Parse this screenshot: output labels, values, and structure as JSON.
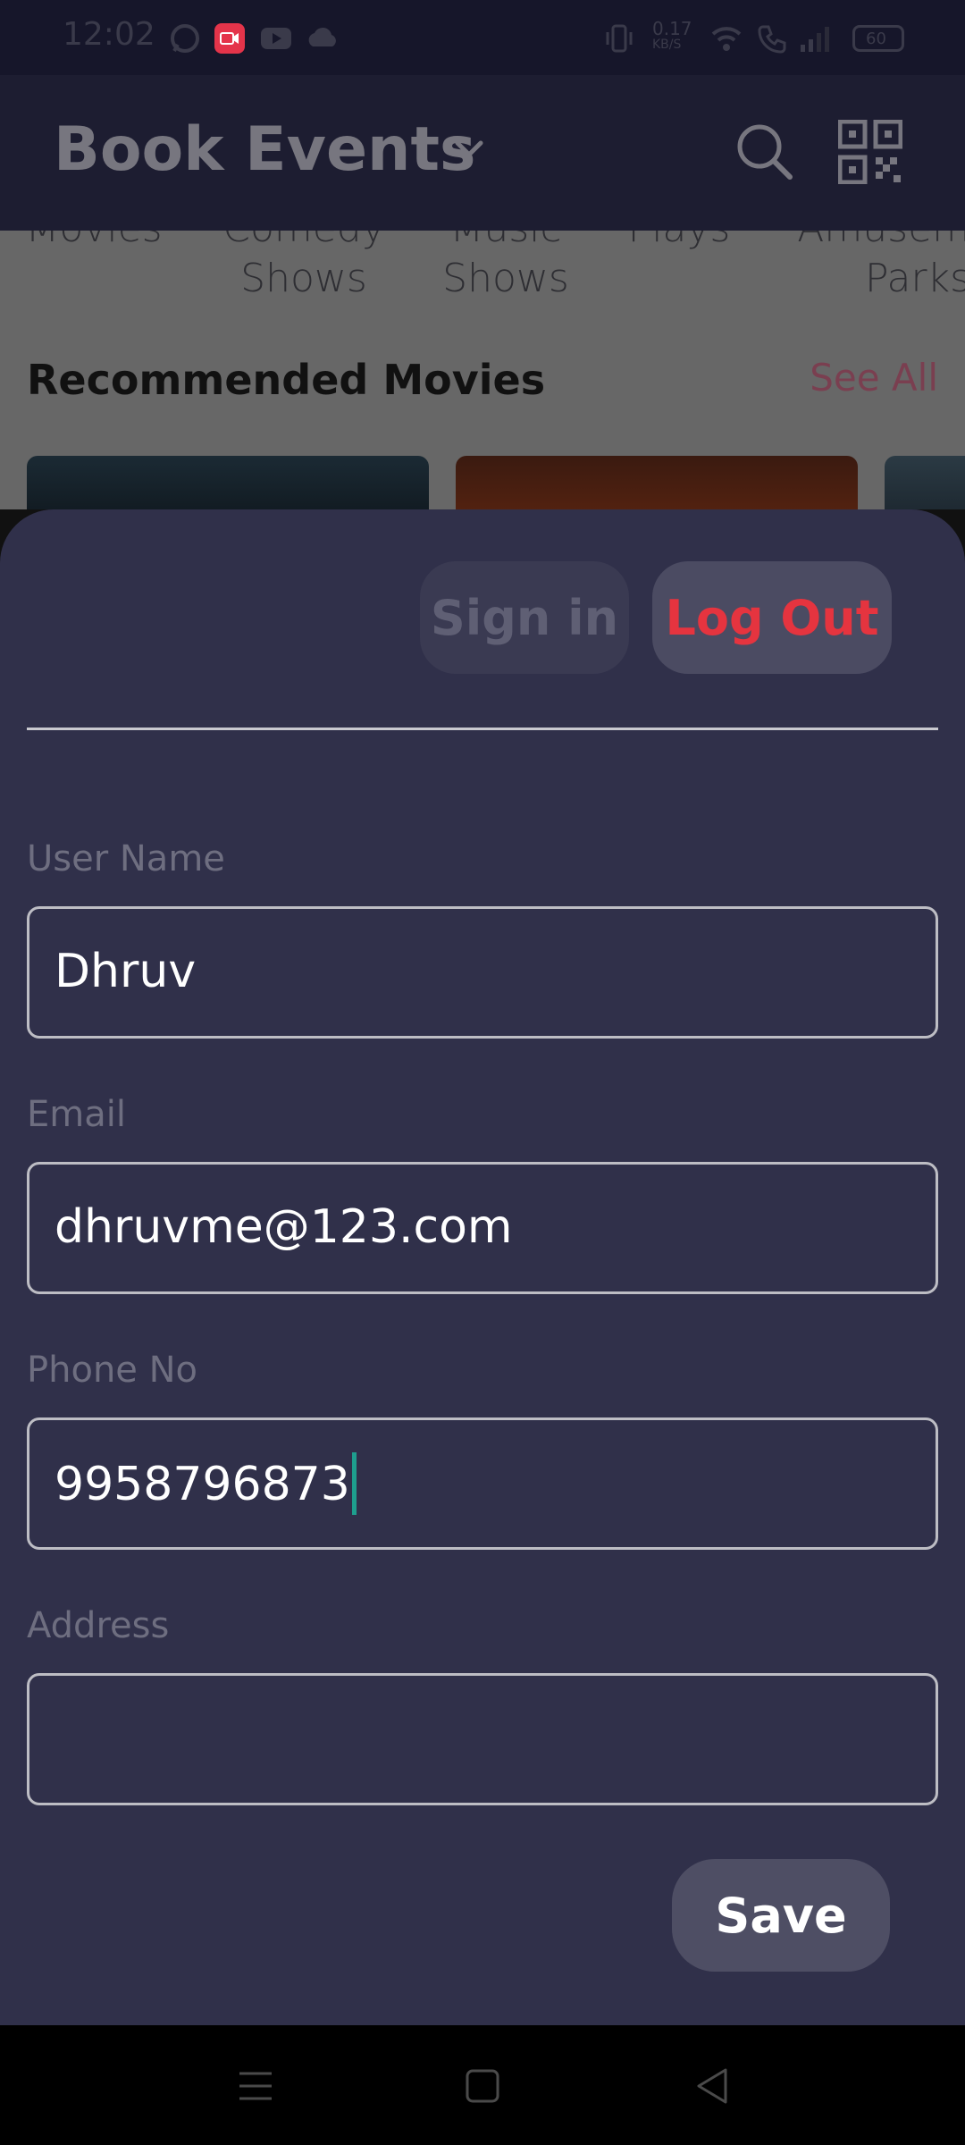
{
  "status_bar": {
    "time": "12:02",
    "net_speed_value": "0.17",
    "net_speed_unit": "KB/S",
    "battery": "60",
    "icons": [
      "whatsapp-icon",
      "screen-record-icon",
      "youtube-icon",
      "cloud-icon",
      "vibrate-icon",
      "wifi-icon",
      "call-icon",
      "signal-icon",
      "battery-icon"
    ]
  },
  "header": {
    "title": "Book Events",
    "icons": [
      "chevron-down-icon",
      "search-icon",
      "qr-code-icon"
    ]
  },
  "background": {
    "categories": [
      {
        "line1": "Movies",
        "line2": ""
      },
      {
        "line1": "Comedy",
        "line2": "Shows"
      },
      {
        "line1": "Music",
        "line2": "Shows"
      },
      {
        "line1": "Plays",
        "line2": ""
      },
      {
        "line1": "Amusem",
        "line2": "Parks"
      }
    ],
    "section_title": "Recommended Movies",
    "see_all": "See All"
  },
  "sheet": {
    "sign_in": "Sign in",
    "log_out": "Log Out",
    "fields": {
      "username": {
        "label": "User Name",
        "value": "Dhruv"
      },
      "email": {
        "label": "Email",
        "value": "dhruvme@123.com"
      },
      "phone": {
        "label": "Phone No",
        "value": "9958796873"
      },
      "address": {
        "label": "Address",
        "value": ""
      }
    },
    "save": "Save"
  },
  "colors": {
    "sheet_bg": "#30304a",
    "logout_text": "#e5343f",
    "caret": "#1e9e8e"
  }
}
